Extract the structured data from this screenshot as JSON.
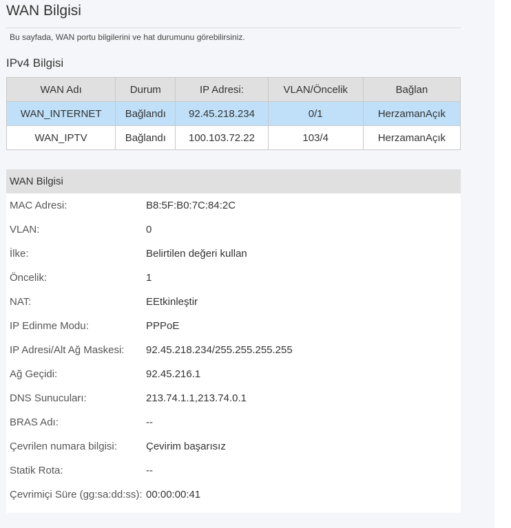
{
  "page": {
    "title": "WAN Bilgisi",
    "description": "Bu sayfada, WAN portu bilgilerini ve hat durumunu görebilirsiniz."
  },
  "ipv4": {
    "section_title": "IPv4 Bilgisi",
    "columns": [
      "WAN Adı",
      "Durum",
      "IP Adresi:",
      "VLAN/Öncelik",
      "Bağlan"
    ],
    "rows": [
      {
        "name": "WAN_INTERNET",
        "status": "Bağlandı",
        "ip": "92.45.218.234",
        "vlan": "0/1",
        "connect": "HerzamanAçık",
        "selected": true
      },
      {
        "name": "WAN_IPTV",
        "status": "Bağlandı",
        "ip": "100.103.72.22",
        "vlan": "103/4",
        "connect": "HerzamanAçık",
        "selected": false
      }
    ]
  },
  "wan_info": {
    "header": "WAN Bilgisi",
    "fields": [
      {
        "label": "MAC Adresi:",
        "value": "B8:5F:B0:7C:84:2C"
      },
      {
        "label": "VLAN:",
        "value": "0"
      },
      {
        "label": "İlke:",
        "value": "Belirtilen değeri kullan"
      },
      {
        "label": "Öncelik:",
        "value": "1"
      },
      {
        "label": "NAT:",
        "value": "EEtkinleştir"
      },
      {
        "label": "IP Edinme Modu:",
        "value": "PPPoE"
      },
      {
        "label": "IP Adresi/Alt Ağ Maskesi:",
        "value": "92.45.218.234/255.255.255.255"
      },
      {
        "label": "Ağ Geçidi:",
        "value": "92.45.216.1"
      },
      {
        "label": "DNS Sunucuları:",
        "value": "213.74.1.1,213.74.0.1"
      },
      {
        "label": "BRAS Adı:",
        "value": "--"
      },
      {
        "label": "Çevrilen numara bilgisi:",
        "value": "Çevirim başarısız"
      },
      {
        "label": "Statik Rota:",
        "value": "--"
      },
      {
        "label": "Çevrimiçi Süre (gg:sa:dd:ss):",
        "value": "00:00:00:41"
      }
    ]
  }
}
